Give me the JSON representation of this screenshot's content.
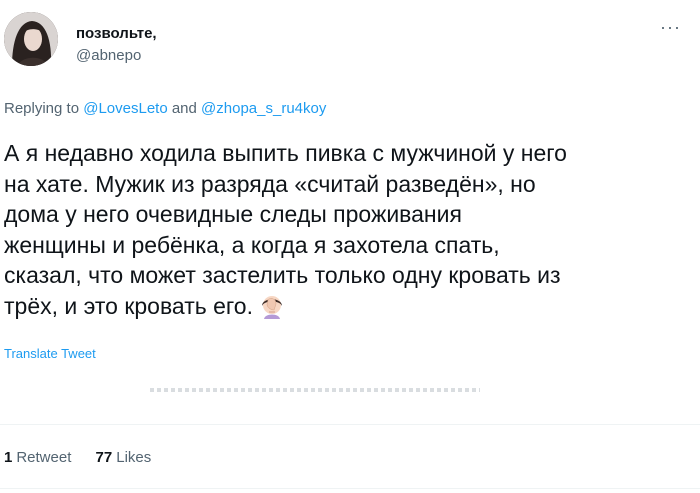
{
  "author": {
    "display_name": "позвольте,",
    "handle": "@abnepo"
  },
  "header": {
    "more_icon": "more-horizontal-icon",
    "more_glyph": "···"
  },
  "reply": {
    "prefix": "Replying to",
    "mention_1": "@LovesLeto",
    "conjunction": "and",
    "mention_2": "@zhopa_s_ru4koy"
  },
  "tweet": {
    "lines": [
      "А я недавно ходила выпить пивка с мужчиной у него",
      "на хате. Мужик из разряда «считай разведён», но",
      "дома у него очевидные следы проживания",
      "женщины и ребёнка, а когда я захотела спать,",
      "сказал, что может застелить только одну кровать из",
      "трёх, и это кровать его."
    ],
    "emoji": "facepalm-woman-emoji",
    "translate_label": "Translate Tweet"
  },
  "stats": {
    "retweets_count": "1",
    "retweets_label": "Retweet",
    "likes_count": "77",
    "likes_label": "Likes"
  },
  "colors": {
    "link": "#1d9bf0",
    "secondary_text": "#536471",
    "primary_text": "#0f1419",
    "divider": "#eff3f4"
  }
}
